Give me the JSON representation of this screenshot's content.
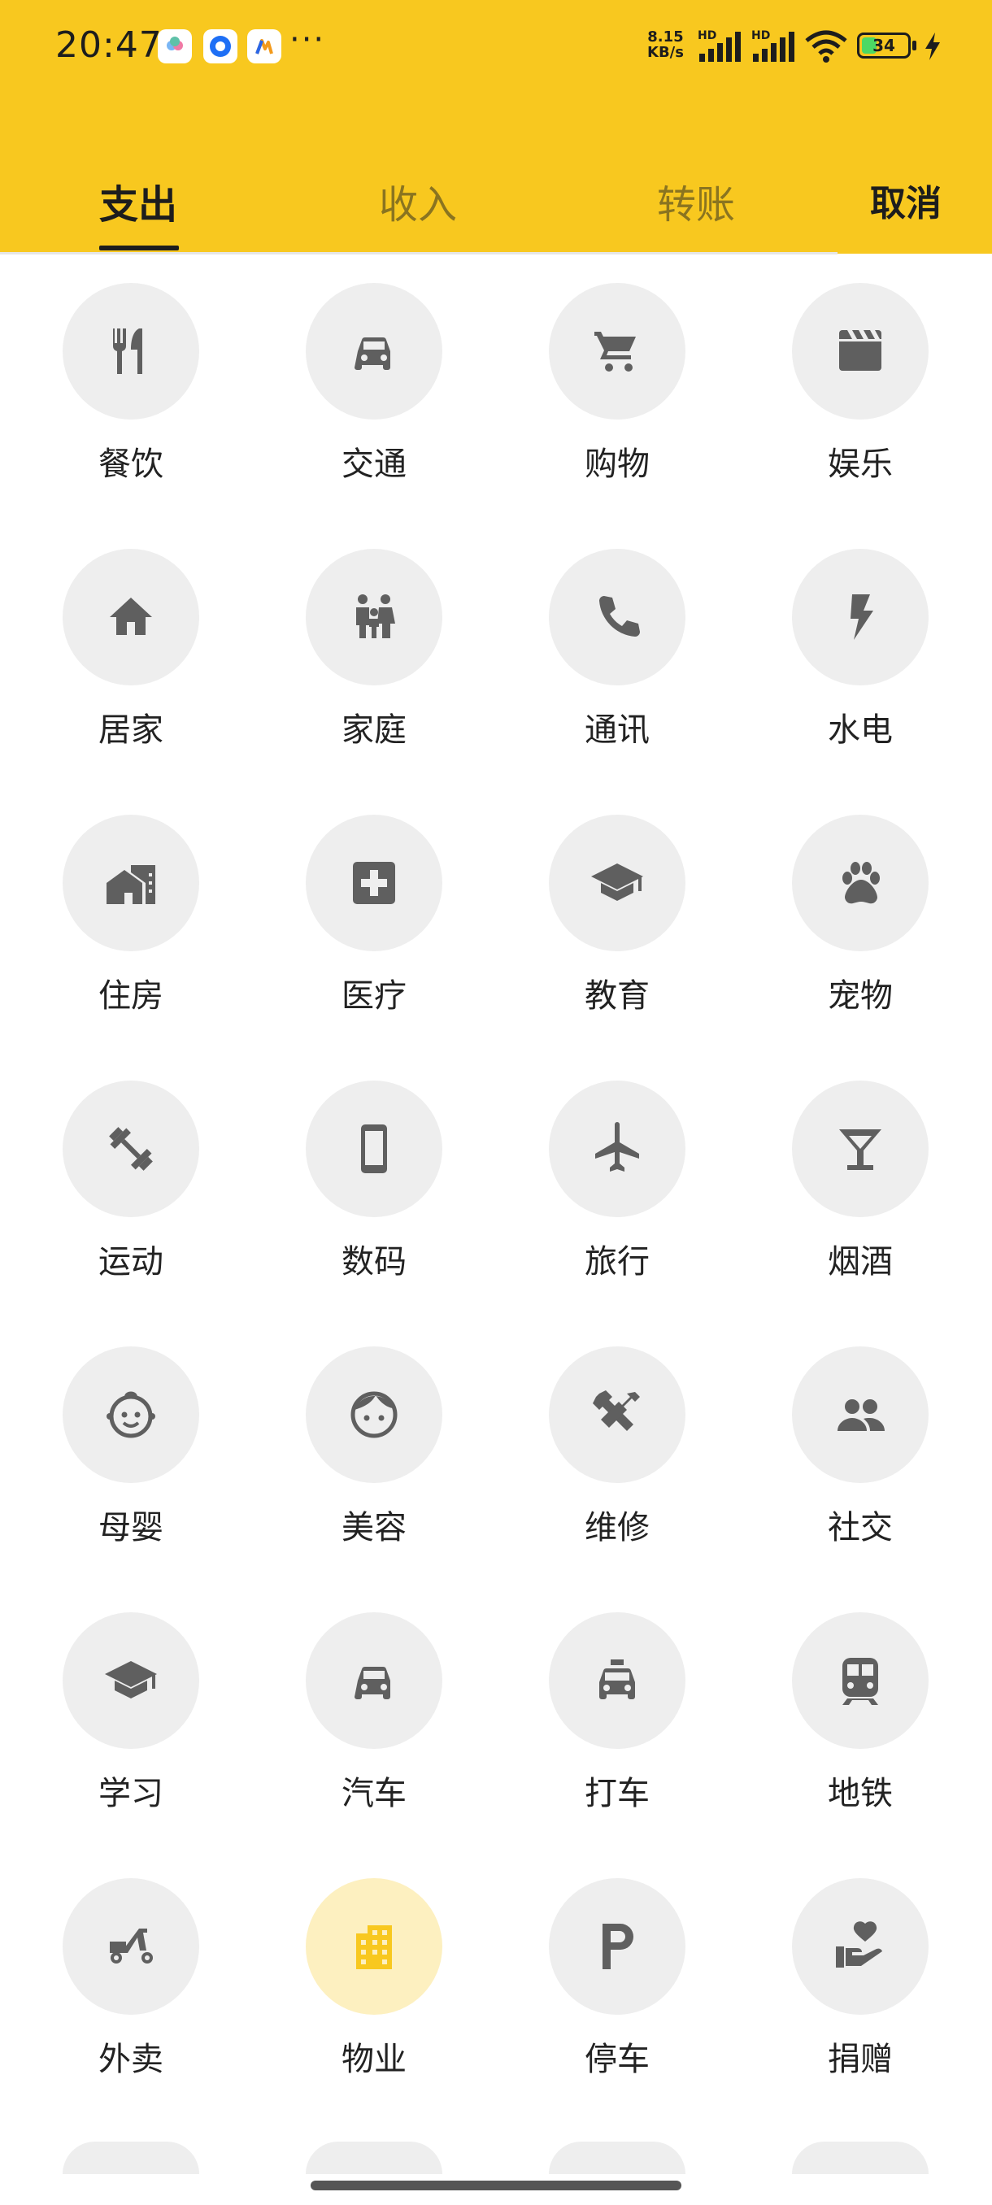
{
  "status_bar": {
    "time": "20:47",
    "net_speed_value": "8.15",
    "net_speed_unit": "KB/s",
    "signal_1_label": "HD",
    "signal_2_label": "HD",
    "battery_level": 34,
    "battery_text": "34",
    "more": "···",
    "colors": {
      "battery_fill": "#4cd964"
    }
  },
  "tabs": [
    {
      "label": "支出",
      "active": true
    },
    {
      "label": "收入",
      "active": false
    },
    {
      "label": "转账",
      "active": false
    }
  ],
  "cancel_label": "取消",
  "colors": {
    "header": "#F8C81F",
    "selected": "#FDF0C0",
    "icon": "#5f5f5f",
    "selected_icon": "#F8C81F"
  },
  "categories": [
    {
      "label": "餐饮",
      "icon": "restaurant-icon"
    },
    {
      "label": "交通",
      "icon": "car-icon"
    },
    {
      "label": "购物",
      "icon": "shopping-cart-icon"
    },
    {
      "label": "娱乐",
      "icon": "clapperboard-icon"
    },
    {
      "label": "居家",
      "icon": "home-icon"
    },
    {
      "label": "家庭",
      "icon": "family-icon"
    },
    {
      "label": "通讯",
      "icon": "phone-icon"
    },
    {
      "label": "水电",
      "icon": "lightning-icon"
    },
    {
      "label": "住房",
      "icon": "house-building-icon"
    },
    {
      "label": "医疗",
      "icon": "medical-cross-icon"
    },
    {
      "label": "教育",
      "icon": "graduation-cap-icon"
    },
    {
      "label": "宠物",
      "icon": "paw-icon"
    },
    {
      "label": "运动",
      "icon": "dumbbell-icon"
    },
    {
      "label": "数码",
      "icon": "smartphone-icon"
    },
    {
      "label": "旅行",
      "icon": "airplane-icon"
    },
    {
      "label": "烟酒",
      "icon": "cocktail-glass-icon"
    },
    {
      "label": "母婴",
      "icon": "baby-face-icon"
    },
    {
      "label": "美容",
      "icon": "face-icon"
    },
    {
      "label": "维修",
      "icon": "tools-icon"
    },
    {
      "label": "社交",
      "icon": "people-icon"
    },
    {
      "label": "学习",
      "icon": "graduation-cap-icon"
    },
    {
      "label": "汽车",
      "icon": "car-icon"
    },
    {
      "label": "打车",
      "icon": "taxi-icon"
    },
    {
      "label": "地铁",
      "icon": "subway-icon"
    },
    {
      "label": "外卖",
      "icon": "scooter-icon"
    },
    {
      "label": "物业",
      "icon": "apartment-building-icon",
      "selected": true
    },
    {
      "label": "停车",
      "icon": "parking-icon"
    },
    {
      "label": "捐赠",
      "icon": "donation-heart-icon"
    }
  ]
}
